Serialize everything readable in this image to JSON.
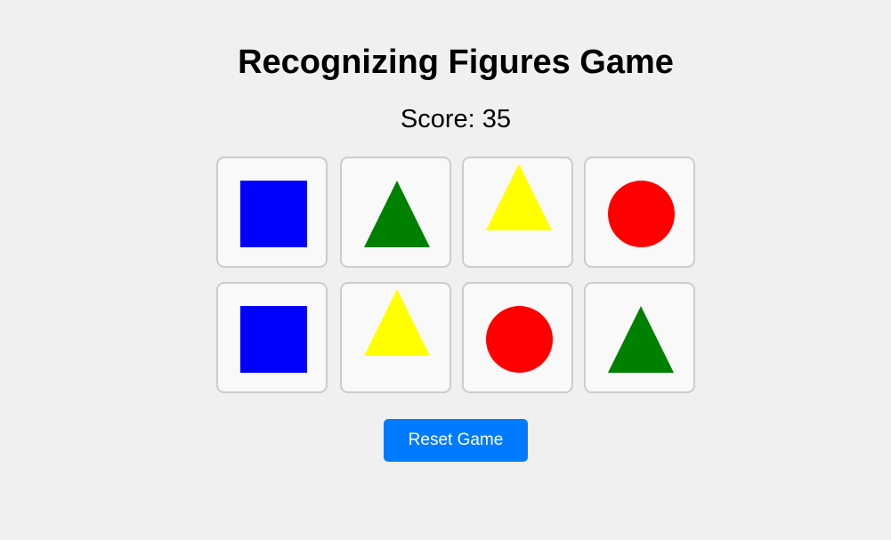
{
  "title": "Recognizing Figures Game",
  "score": {
    "label": "Score: 35",
    "value": 35
  },
  "colors": {
    "blue": "#0000ff",
    "green": "#008000",
    "yellow": "#ffff00",
    "red": "#ff0000",
    "button": "#007bff"
  },
  "cards": [
    {
      "shape": "square",
      "color": "blue"
    },
    {
      "shape": "triangle",
      "color": "green"
    },
    {
      "shape": "triangle",
      "color": "yellow"
    },
    {
      "shape": "circle",
      "color": "red"
    },
    {
      "shape": "square",
      "color": "blue"
    },
    {
      "shape": "triangle",
      "color": "yellow"
    },
    {
      "shape": "circle",
      "color": "red"
    },
    {
      "shape": "triangle",
      "color": "green"
    }
  ],
  "reset_button": {
    "label": "Reset Game"
  }
}
